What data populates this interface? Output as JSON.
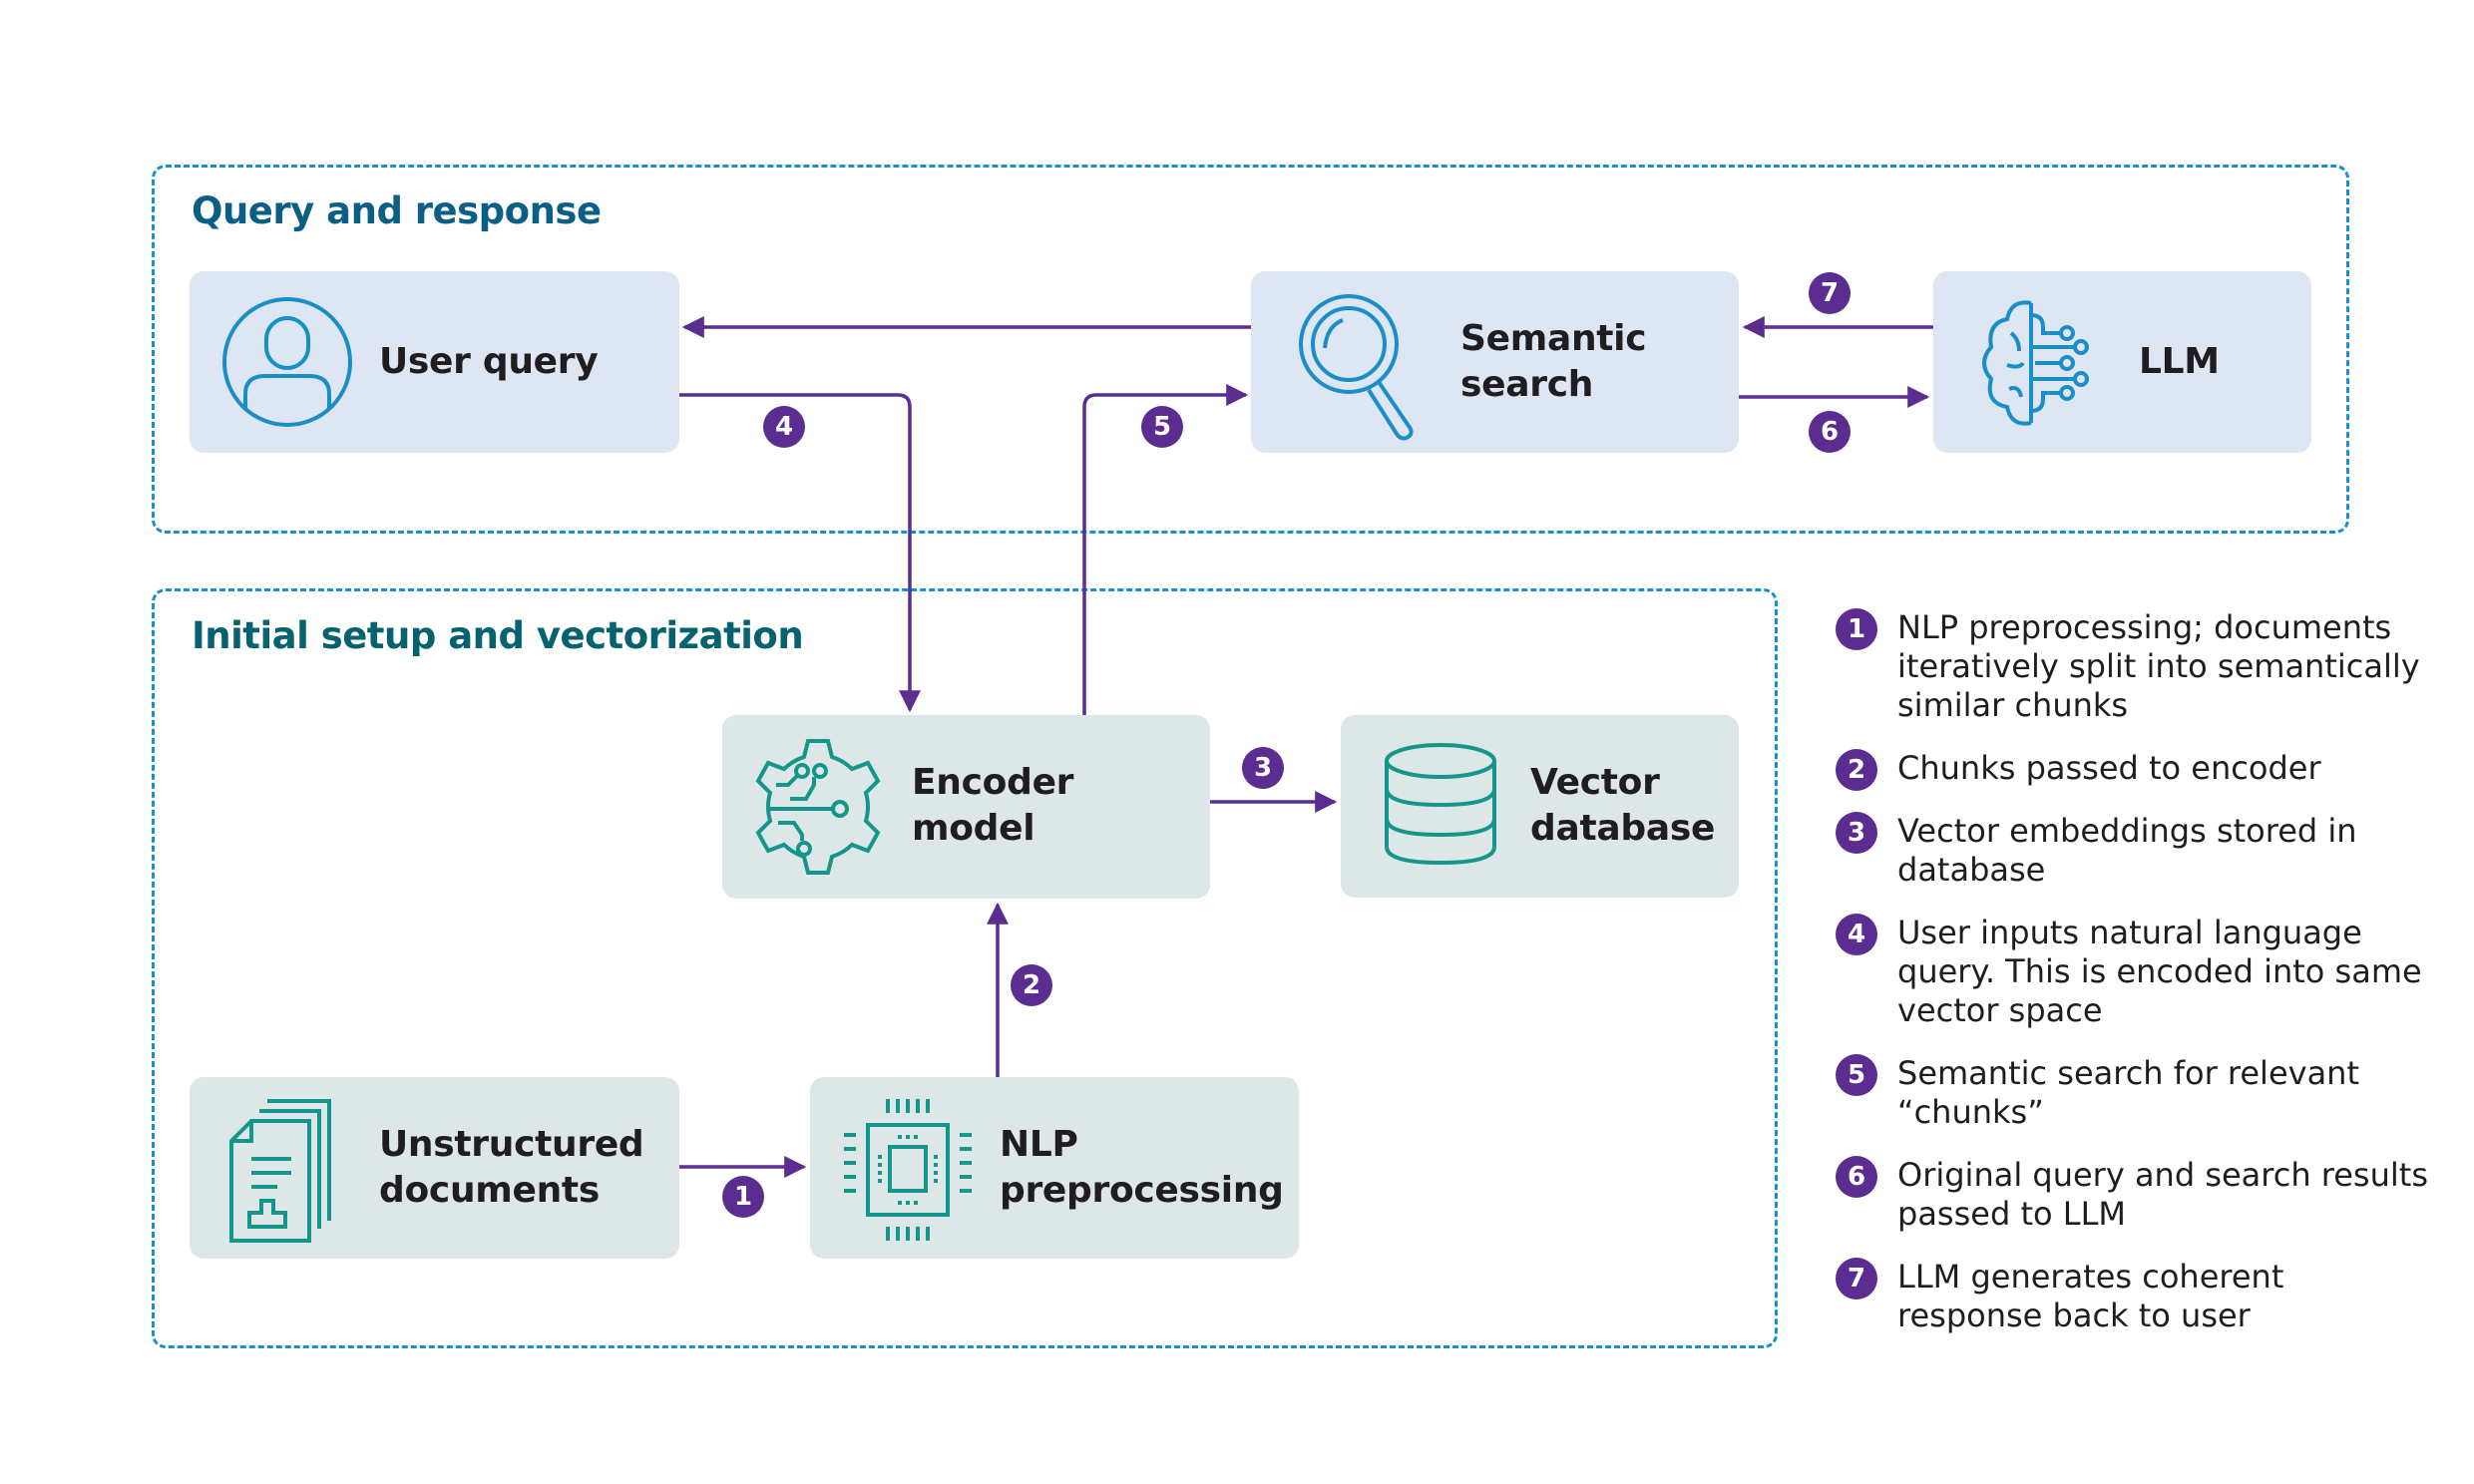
{
  "sections": {
    "query": {
      "title": "Query and response",
      "color": "#0b5f87"
    },
    "setup": {
      "title": "Initial setup and vectorization",
      "color": "#05626e"
    }
  },
  "nodes": {
    "user_query": {
      "label_lines": [
        "User query"
      ],
      "icon": "user-icon"
    },
    "semantic_search": {
      "label_lines": [
        "Semantic",
        "search"
      ],
      "icon": "magnifier-icon"
    },
    "llm": {
      "label_lines": [
        "LLM"
      ],
      "icon": "brain-circuit-icon"
    },
    "encoder": {
      "label_lines": [
        "Encoder",
        "model"
      ],
      "icon": "gear-circuit-icon"
    },
    "vector_db": {
      "label_lines": [
        "Vector",
        "database"
      ],
      "icon": "database-icon"
    },
    "documents": {
      "label_lines": [
        "Unstructured",
        "documents"
      ],
      "icon": "documents-icon"
    },
    "nlp": {
      "label_lines": [
        "NLP",
        "preprocessing"
      ],
      "icon": "chip-icon"
    }
  },
  "steps": [
    {
      "num": "1",
      "text": "NLP preprocessing; documents iteratively split into semantically similar chunks"
    },
    {
      "num": "2",
      "text": "Chunks passed to encoder"
    },
    {
      "num": "3",
      "text": "Vector embeddings stored in database"
    },
    {
      "num": "4",
      "text": "User inputs natural language query. This is encoded into same vector space"
    },
    {
      "num": "5",
      "text": "Semantic search for relevant “chunks”"
    },
    {
      "num": "6",
      "text": "Original query and search results passed to LLM"
    },
    {
      "num": "7",
      "text": "LLM generates coherent response back to user"
    }
  ],
  "colors": {
    "arrow": "#5b2d90",
    "dashed_border": "#1a8fcf",
    "query_icon": "#1a8fc7",
    "setup_icon": "#14968a"
  }
}
